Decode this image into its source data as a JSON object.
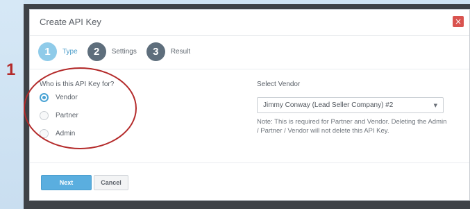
{
  "dialog": {
    "title": "Create API Key",
    "close_glyph": "×"
  },
  "steps": [
    {
      "number": "1",
      "label": "Type",
      "state": "active"
    },
    {
      "number": "2",
      "label": "Settings",
      "state": "inactive"
    },
    {
      "number": "3",
      "label": "Result",
      "state": "inactive"
    }
  ],
  "key_for": {
    "question": "Who is this API Key for?",
    "options": [
      {
        "label": "Vendor",
        "checked": true
      },
      {
        "label": "Partner",
        "checked": false
      },
      {
        "label": "Admin",
        "checked": false
      }
    ]
  },
  "vendor": {
    "label": "Select Vendor",
    "selected": "Jimmy Conway (Lead Seller Company) #2",
    "note": "Note: This is required for Partner and Vendor. Deleting the Admin / Partner / Vendor will not delete this API Key."
  },
  "footer": {
    "next_label": "Next",
    "cancel_label": "Cancel"
  },
  "annotation": {
    "number": "1",
    "color": "#b42a2a"
  },
  "colors": {
    "accent": "#4aa3d4",
    "step_active": "#8fcbe9",
    "step_inactive": "#5e6e7c",
    "close": "#d9534f"
  }
}
